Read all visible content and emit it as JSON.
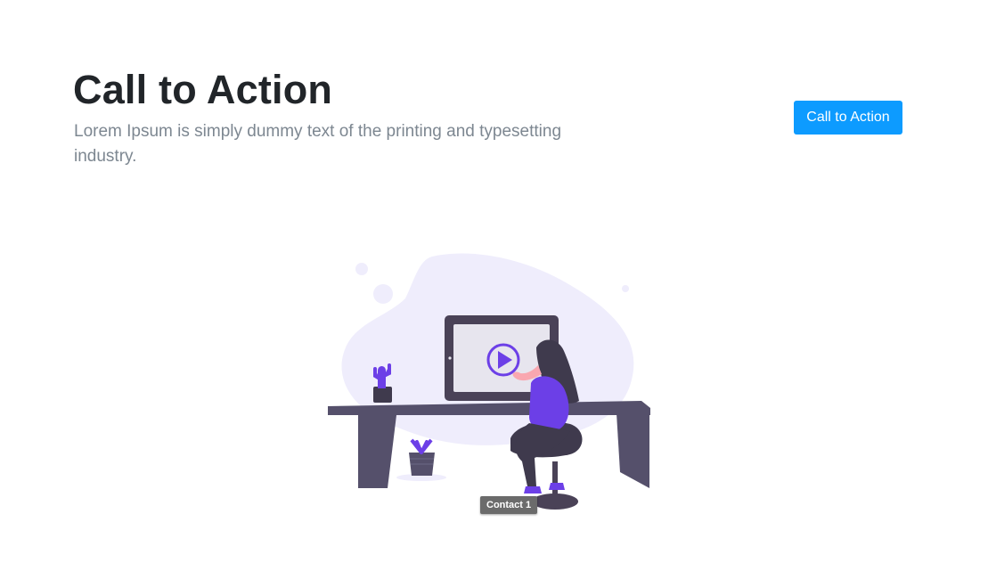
{
  "hero": {
    "title": "Call to Action",
    "subtitle": "Lorem Ipsum is simply dummy text of the printing and typesetting industry."
  },
  "cta": {
    "label": "Call to Action",
    "color": "#0d9bff"
  },
  "illustration": {
    "icon": "woman-at-desk-watching-video-illustration"
  },
  "tooltip": {
    "label": "Contact 1"
  }
}
